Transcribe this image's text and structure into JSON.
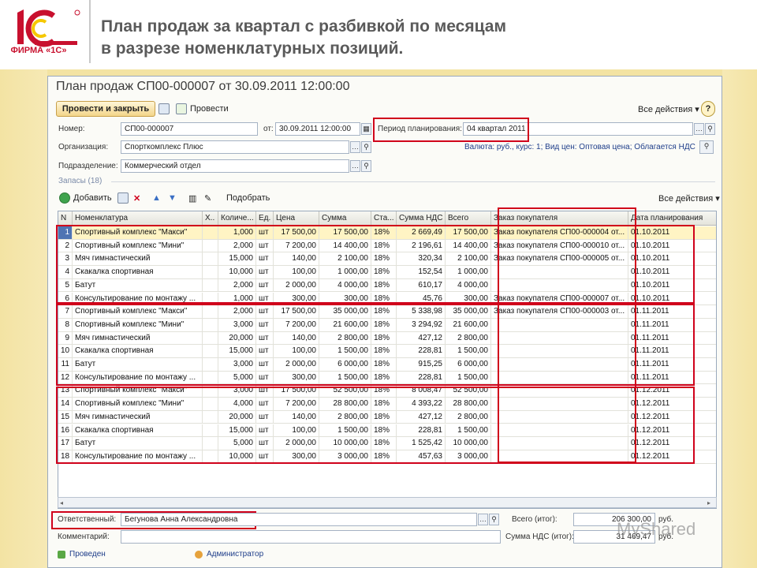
{
  "slide": {
    "logo_text": "ФИРМА «1С»",
    "title_line1": "План продаж за квартал с разбивкой по месяцам",
    "title_line2": "в разрезе номенклатурных позиций."
  },
  "window": {
    "title": "План продаж СП00-000007 от 30.09.2011 12:00:00",
    "toolbar": {
      "post_close": "Провести и закрыть",
      "post": "Провести",
      "all_actions": "Все действия ▾",
      "help": "?"
    },
    "form": {
      "number_label": "Номер:",
      "number_value": "СП00-000007",
      "date_label": "от:",
      "date_value": "30.09.2011 12:00:00",
      "period_label": "Период планирования:",
      "period_value": "04 квартал 2011",
      "org_label": "Организация:",
      "org_value": "Спорткомплекс Плюс",
      "currency_info": "Валюта: руб., курс: 1; Вид цен: Оптовая цена; Облагается НДС",
      "dept_label": "Подразделение:",
      "dept_value": "Коммерческий отдел",
      "stock_header": "Запасы (18)"
    },
    "grid_toolbar": {
      "add": "Добавить",
      "pick": "Подобрать",
      "all_actions": "Все действия ▾"
    },
    "columns": [
      "N",
      "Номенклатура",
      "Х..",
      "Количе...",
      "Ед.",
      "Цена",
      "Сумма",
      "Ста...",
      "Сумма НДС",
      "Всего",
      "Заказ покупателя",
      "Дата планирования"
    ],
    "rows": [
      [
        "1",
        "Спортивный комплекс \"Макси\"",
        "",
        "1,000",
        "шт",
        "17 500,00",
        "17 500,00",
        "18%",
        "2 669,49",
        "17 500,00",
        "Заказ покупателя СП00-000004 от...",
        "01.10.2011"
      ],
      [
        "2",
        "Спортивный комплекс \"Мини\"",
        "",
        "2,000",
        "шт",
        "7 200,00",
        "14 400,00",
        "18%",
        "2 196,61",
        "14 400,00",
        "Заказ покупателя СП00-000010 от...",
        "01.10.2011"
      ],
      [
        "3",
        "Мяч гимнастический",
        "",
        "15,000",
        "шт",
        "140,00",
        "2 100,00",
        "18%",
        "320,34",
        "2 100,00",
        "Заказ покупателя СП00-000005 от...",
        "01.10.2011"
      ],
      [
        "4",
        "Скакалка спортивная",
        "",
        "10,000",
        "шт",
        "100,00",
        "1 000,00",
        "18%",
        "152,54",
        "1 000,00",
        "",
        "01.10.2011"
      ],
      [
        "5",
        "Батут",
        "",
        "2,000",
        "шт",
        "2 000,00",
        "4 000,00",
        "18%",
        "610,17",
        "4 000,00",
        "",
        "01.10.2011"
      ],
      [
        "6",
        "Консультирование по монтажу ...",
        "",
        "1,000",
        "шт",
        "300,00",
        "300,00",
        "18%",
        "45,76",
        "300,00",
        "Заказ покупателя СП00-000007 от...",
        "01.10.2011"
      ],
      [
        "7",
        "Спортивный комплекс \"Макси\"",
        "",
        "2,000",
        "шт",
        "17 500,00",
        "35 000,00",
        "18%",
        "5 338,98",
        "35 000,00",
        "Заказ покупателя СП00-000003 от...",
        "01.11.2011"
      ],
      [
        "8",
        "Спортивный комплекс \"Мини\"",
        "",
        "3,000",
        "шт",
        "7 200,00",
        "21 600,00",
        "18%",
        "3 294,92",
        "21 600,00",
        "",
        "01.11.2011"
      ],
      [
        "9",
        "Мяч гимнастический",
        "",
        "20,000",
        "шт",
        "140,00",
        "2 800,00",
        "18%",
        "427,12",
        "2 800,00",
        "",
        "01.11.2011"
      ],
      [
        "10",
        "Скакалка спортивная",
        "",
        "15,000",
        "шт",
        "100,00",
        "1 500,00",
        "18%",
        "228,81",
        "1 500,00",
        "",
        "01.11.2011"
      ],
      [
        "11",
        "Батут",
        "",
        "3,000",
        "шт",
        "2 000,00",
        "6 000,00",
        "18%",
        "915,25",
        "6 000,00",
        "",
        "01.11.2011"
      ],
      [
        "12",
        "Консультирование по монтажу ...",
        "",
        "5,000",
        "шт",
        "300,00",
        "1 500,00",
        "18%",
        "228,81",
        "1 500,00",
        "",
        "01.11.2011"
      ],
      [
        "13",
        "Спортивный комплекс \"Макси\"",
        "",
        "3,000",
        "шт",
        "17 500,00",
        "52 500,00",
        "18%",
        "8 008,47",
        "52 500,00",
        "",
        "01.12.2011"
      ],
      [
        "14",
        "Спортивный комплекс \"Мини\"",
        "",
        "4,000",
        "шт",
        "7 200,00",
        "28 800,00",
        "18%",
        "4 393,22",
        "28 800,00",
        "",
        "01.12.2011"
      ],
      [
        "15",
        "Мяч гимнастический",
        "",
        "20,000",
        "шт",
        "140,00",
        "2 800,00",
        "18%",
        "427,12",
        "2 800,00",
        "",
        "01.12.2011"
      ],
      [
        "16",
        "Скакалка спортивная",
        "",
        "15,000",
        "шт",
        "100,00",
        "1 500,00",
        "18%",
        "228,81",
        "1 500,00",
        "",
        "01.12.2011"
      ],
      [
        "17",
        "Батут",
        "",
        "5,000",
        "шт",
        "2 000,00",
        "10 000,00",
        "18%",
        "1 525,42",
        "10 000,00",
        "",
        "01.12.2011"
      ],
      [
        "18",
        "Консультирование по монтажу ...",
        "",
        "10,000",
        "шт",
        "300,00",
        "3 000,00",
        "18%",
        "457,63",
        "3 000,00",
        "",
        "01.12.2011"
      ]
    ],
    "footer": {
      "responsible_label": "Ответственный:",
      "responsible_value": "Бегунова Анна Александровна",
      "comment_label": "Комментарий:",
      "total_label": "Всего (итог):",
      "total_value": "206 300,00",
      "total_currency": "руб.",
      "vat_label": "Сумма НДС (итог):",
      "vat_value": "31 469,47",
      "vat_currency": "руб.",
      "status": "Проведен",
      "user": "Администратор"
    }
  },
  "watermark": "MyShared"
}
